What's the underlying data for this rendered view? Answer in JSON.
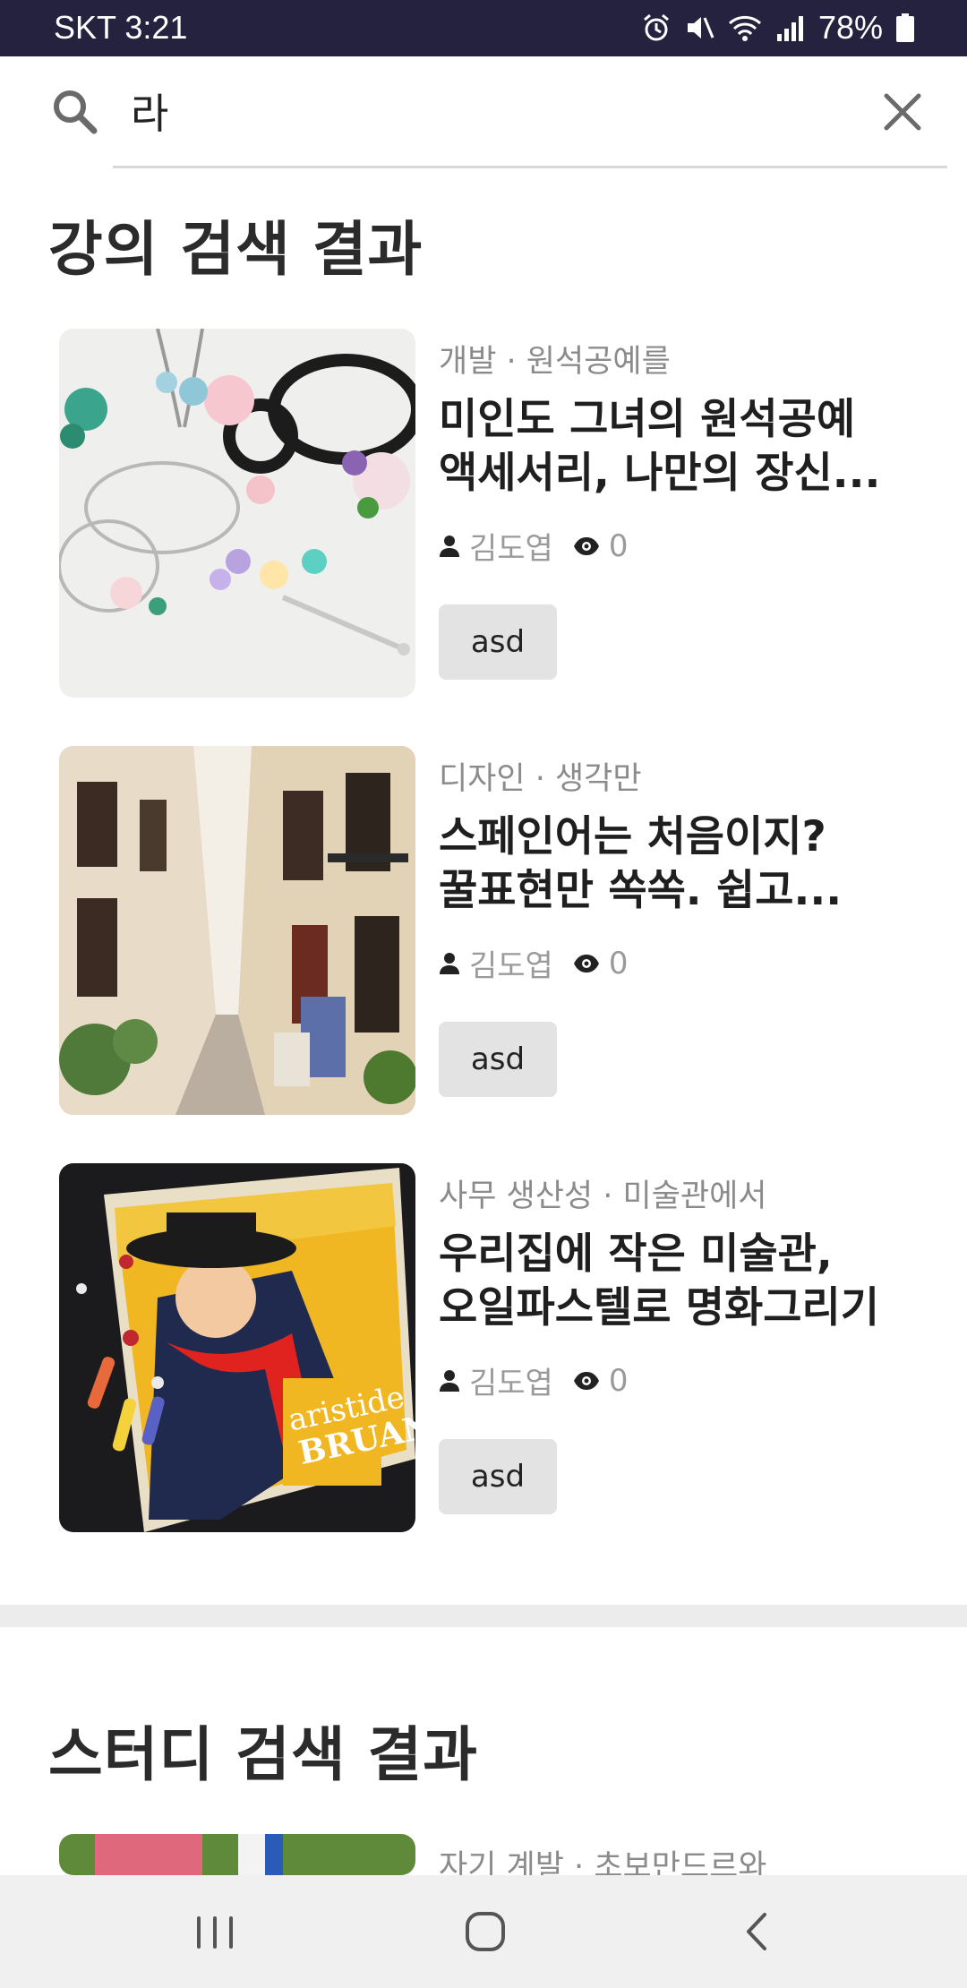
{
  "status": {
    "carrier_time": "SKT 3:21",
    "battery": "78%"
  },
  "search": {
    "query": "라",
    "placeholder": ""
  },
  "lecture_section": {
    "title": "강의 검색 결과",
    "items": [
      {
        "category": "개발 · 원석공예를",
        "title_line1": "미인도 그녀의 원석공예",
        "title_line2": "액세서리, 나만의 장신...",
        "author": "김도엽",
        "views": "0",
        "tag": "asd"
      },
      {
        "category": "디자인 · 생각만",
        "title_line1": "스페인어는 처음이지?",
        "title_line2": "꿀표현만 쏙쏙. 쉽고...",
        "author": "김도엽",
        "views": "0",
        "tag": "asd"
      },
      {
        "category": "사무 생산성 · 미술관에서",
        "title_line1": "우리집에 작은 미술관,",
        "title_line2": "오일파스텔로 명화그리기",
        "author": "김도엽",
        "views": "0",
        "tag": "asd"
      }
    ]
  },
  "study_section": {
    "title": "스터디 검색 결과",
    "items": [
      {
        "category": "자기 계발 · 초보만드르와"
      }
    ]
  },
  "colors": {
    "status_bar": "#24223f",
    "tag_bg": "#e3e3e3",
    "divider": "#ececec",
    "nav_bg": "#f0f0f0"
  }
}
